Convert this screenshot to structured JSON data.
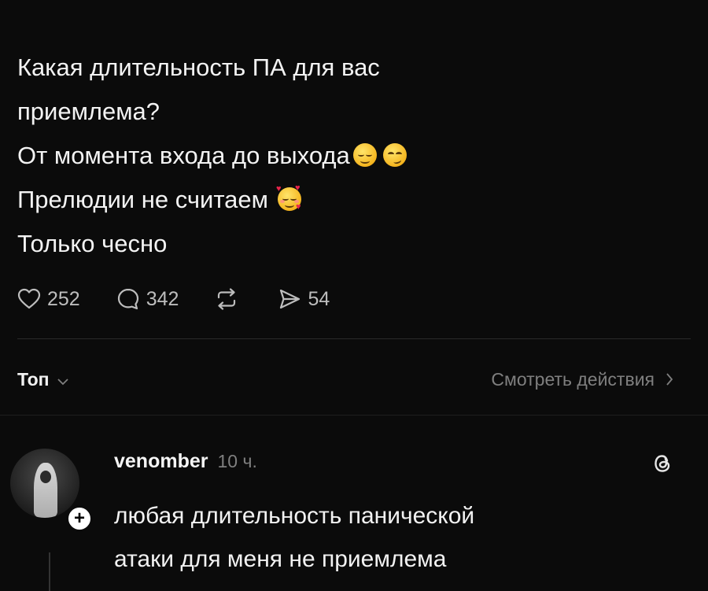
{
  "post": {
    "lines": [
      "Какая длительность ПА для вас",
      "приемлема?",
      "От момента входа до выхода",
      "Прелюдии не считаем",
      "Только чесно"
    ],
    "emojis": [
      "relieved-face",
      "smirking-face",
      "smiling-face-with-hearts"
    ]
  },
  "actions": {
    "likes": "252",
    "comments": "342",
    "shares": "54"
  },
  "sort": {
    "label": "Топ",
    "view_activity": "Смотреть действия"
  },
  "reply": {
    "username": "venomber",
    "time": "10 ч.",
    "lines": [
      "любая длительность панической",
      "атаки для меня не приемлема"
    ]
  },
  "colors": {
    "background": "#0b0b0b",
    "text": "#f2f2f2",
    "muted": "#7f7f7f"
  }
}
